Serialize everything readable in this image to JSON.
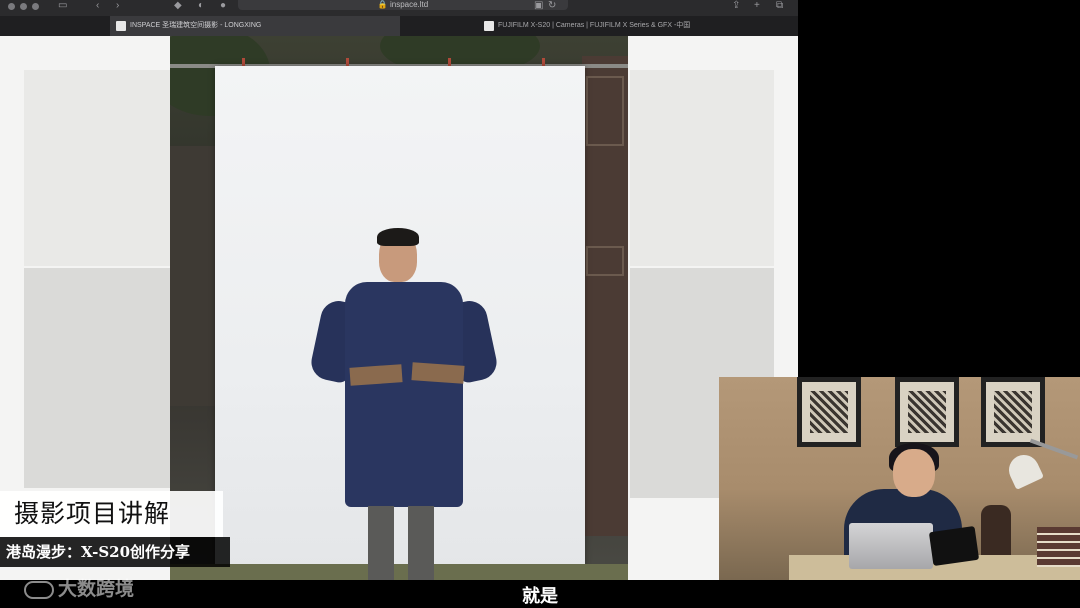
{
  "browser": {
    "url": "inspace.ltd",
    "tabs": [
      {
        "label": "INSPACE 圣瑞建筑空间摄影 - LONGXING",
        "active": true
      },
      {
        "label": "FUJIFILM X-S20 | Cameras | FUJIFILM X Series & GFX -中国",
        "active": false
      }
    ]
  },
  "captions": {
    "title": "摄影项目讲解",
    "subtitle": "港岛漫步：X-S20创作分享"
  },
  "watermark": {
    "text": "大数跨境"
  },
  "video_subtitle": "就是",
  "colors": {
    "coat": "#2a3660",
    "backdrop": "#f3f4f5",
    "tab_bar": "#1f1f21"
  }
}
